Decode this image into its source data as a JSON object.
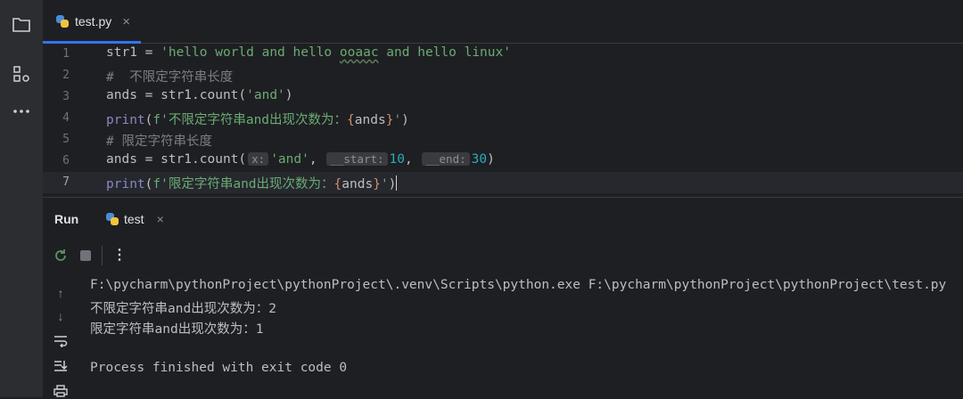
{
  "editor_tab": {
    "filename": "test.py",
    "close": "×"
  },
  "editor": {
    "lines": [
      {
        "n": "1"
      },
      {
        "n": "2"
      },
      {
        "n": "3"
      },
      {
        "n": "4"
      },
      {
        "n": "5"
      },
      {
        "n": "6"
      },
      {
        "n": "7"
      }
    ],
    "code": {
      "l1_a": "str1 = ",
      "l1_str_a": "'hello world and hello ",
      "l1_str_b": "ooaac",
      "l1_str_c": " and hello linux'",
      "l2": "#  不限定字符串长度",
      "l3_a": "ands = str1.count(",
      "l3_str": "'and'",
      "l3_b": ")",
      "l4_fn": "print",
      "l4_a": "(",
      "l4_str_a": "f'不限定字符串and出现次数为：",
      "l4_br_o": "{",
      "l4_var": "ands",
      "l4_br_c": "}",
      "l4_str_b": "'",
      "l4_b": ")",
      "l5": "# 限定字符串长度",
      "l6_a": "ands = str1.count(",
      "l6_hint_x": "x:",
      "l6_str": "'and'",
      "l6_comma1": ",",
      "l6_hint_start": "__start:",
      "l6_n1": "10",
      "l6_comma2": ",",
      "l6_hint_end": "__end:",
      "l6_n2": "30",
      "l6_b": ")",
      "l7_fn": "print",
      "l7_a": "(",
      "l7_str_a": "f'限定字符串and出现次数为：",
      "l7_br_o": "{",
      "l7_var": "ands",
      "l7_br_c": "}",
      "l7_str_b": "'",
      "l7_b": ")"
    }
  },
  "run_panel": {
    "title": "Run",
    "tab_label": "test",
    "tab_close": "×",
    "console": [
      "F:\\pycharm\\pythonProject\\pythonProject\\.venv\\Scripts\\python.exe F:\\pycharm\\pythonProject\\pythonProject\\test.py",
      "不限定字符串and出现次数为：2",
      "限定字符串and出现次数为：1",
      "",
      "Process finished with exit code 0"
    ]
  },
  "colors": {
    "accent": "#3574f0",
    "string": "#6aab73",
    "comment": "#7a7e85",
    "number": "#2aacb8",
    "builtin": "#8888c6"
  }
}
